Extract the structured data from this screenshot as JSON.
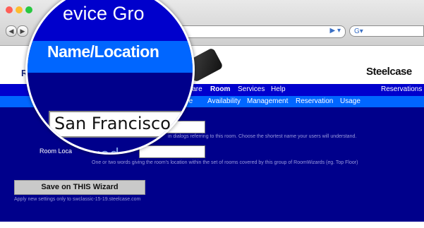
{
  "browser": {
    "nav_back": "◀",
    "nav_forward": "▶",
    "url_controls": "▶ ▾",
    "search_icon": "G▾"
  },
  "site": {
    "title": "Ro",
    "brand": "Steelcase",
    "top_nav": [
      "ware",
      "Room",
      "Services",
      "Help"
    ],
    "top_nav_right": "Reservations",
    "sub_nav": [
      "ture",
      "Availability",
      "Management",
      "Reservation",
      "Usage"
    ]
  },
  "form": {
    "name_help": "in dialogs referring to this room. Choose the shortest name your users will understand.",
    "location_label": "Room Loca",
    "location_help": "One or two words giving the room's location within the set of rooms covered by this group of RoomWizards (eg. Top Floor)",
    "save_label": "Save on THIS Wizard",
    "apply_note": "Apply new settings only to swclassic-15-19.steelcase.com"
  },
  "magnifier": {
    "tabs_text": "evice    Gro",
    "section_title": "Name/Location",
    "name_value": "San Francisco",
    "location_value": "layed on t"
  },
  "colors": {
    "top_nav": "#0000cc",
    "sub_nav": "#0066ff",
    "content": "#00008b"
  }
}
